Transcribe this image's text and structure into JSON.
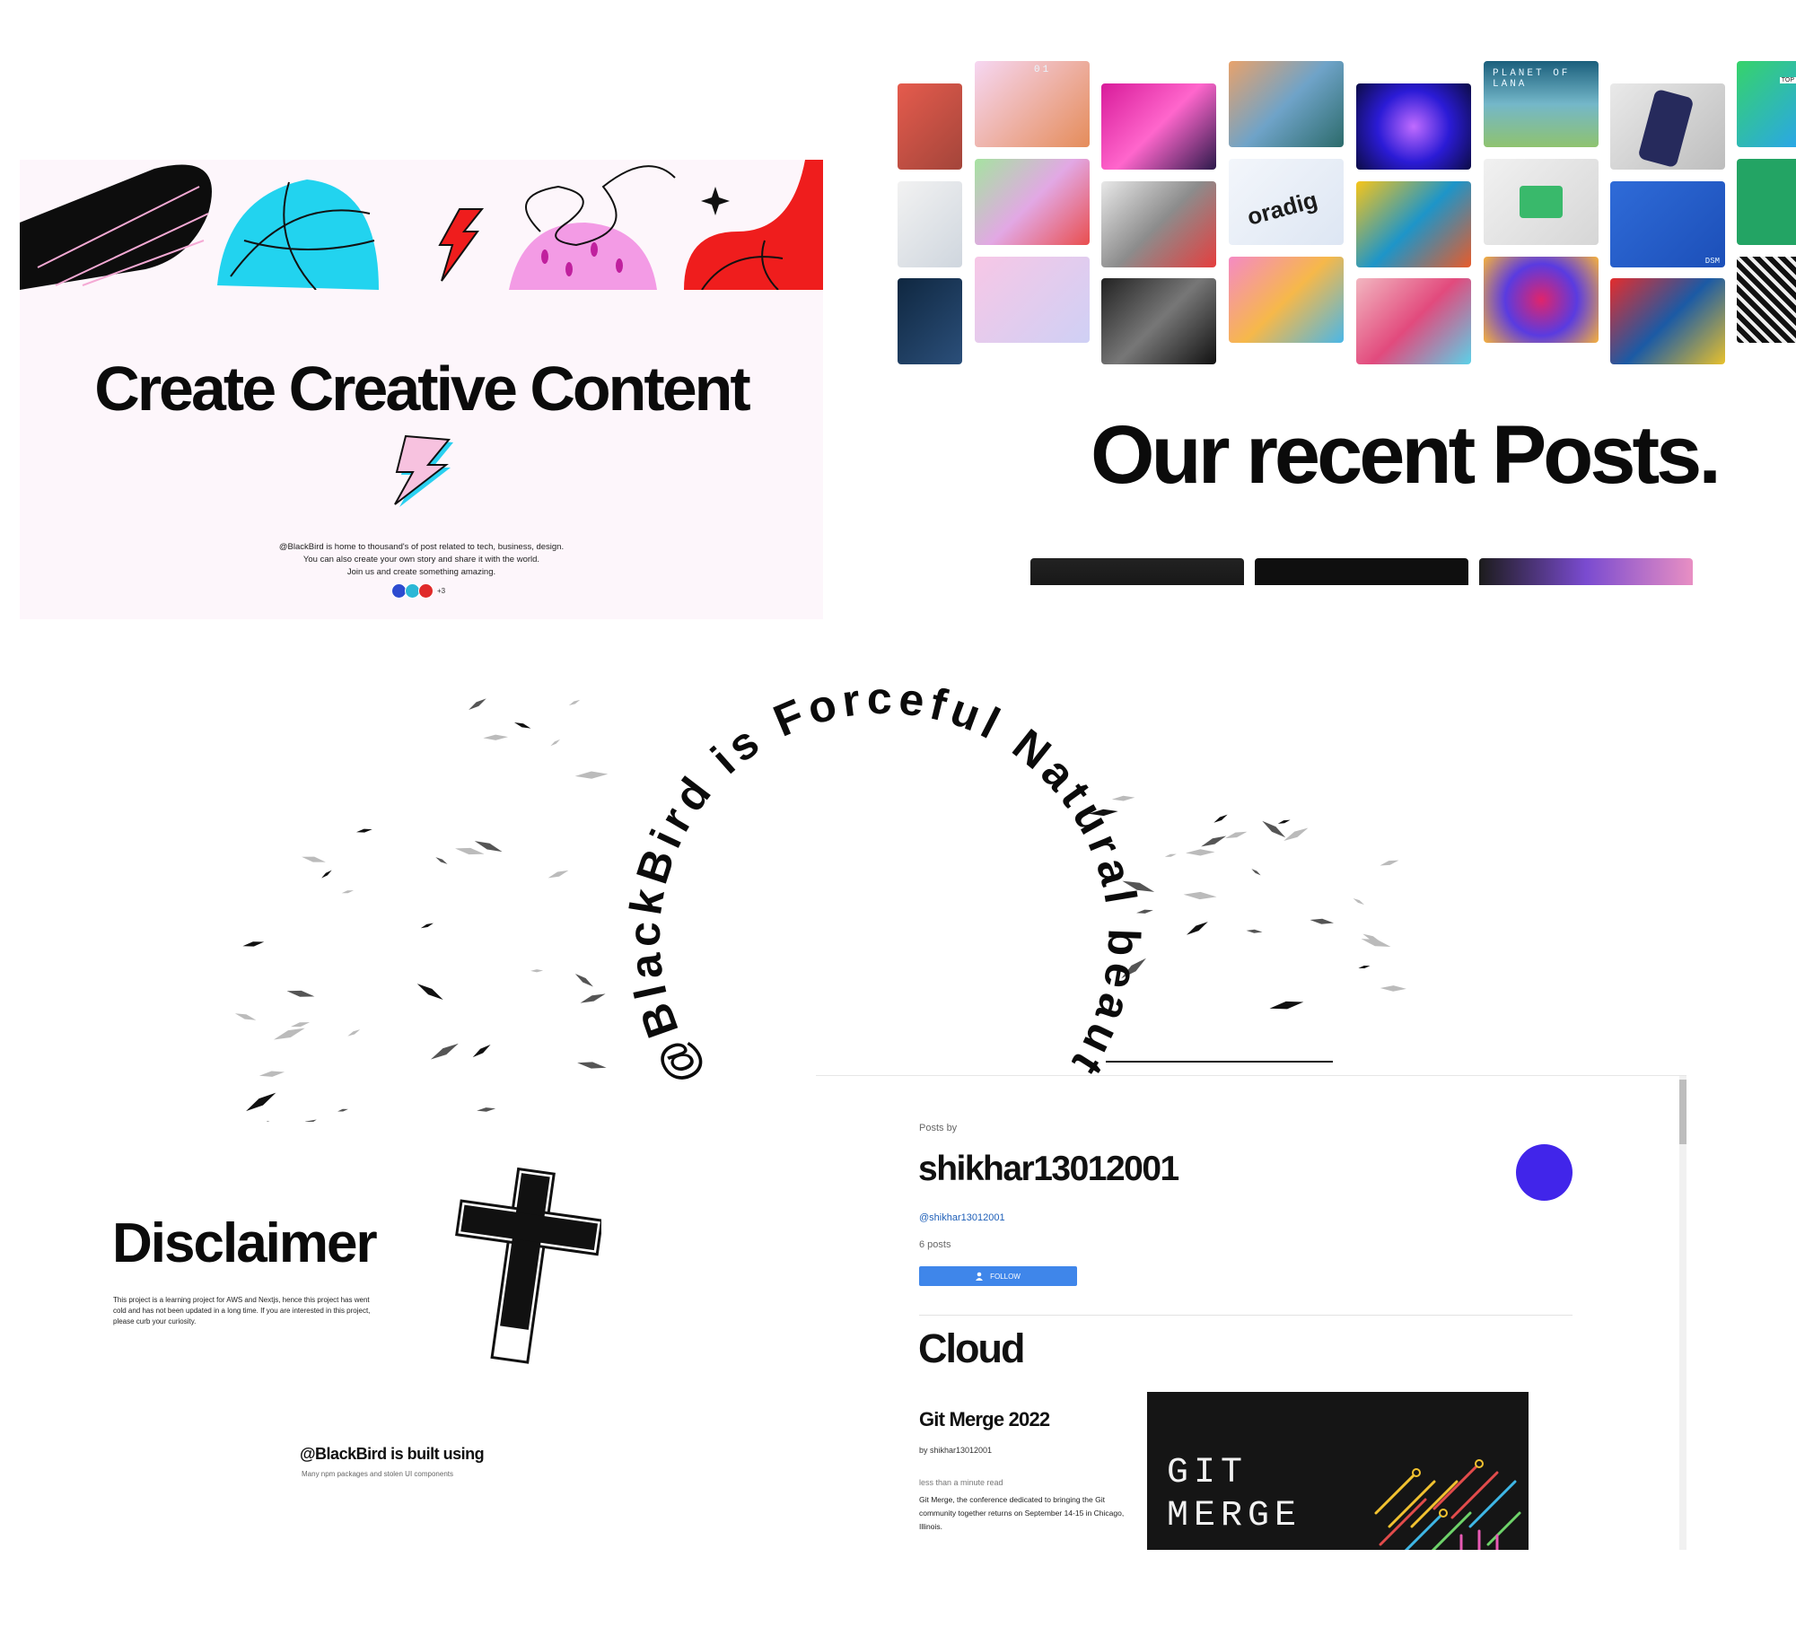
{
  "hero": {
    "title": "Create Creative Content",
    "description_lines": [
      "@BlackBird is home to thousand's of post related to tech, business, design.",
      "You can also create your own story and share it with the world.",
      "Join us and create something amazing."
    ],
    "avatar_count_extra": "+3",
    "colors": {
      "background": "#fdf6fb",
      "bolt": "#f7c2df",
      "bolt_shadow": "#2ad0f0"
    }
  },
  "gallery": {
    "tiles": [
      {
        "label": "PLANET OF LANA"
      },
      {
        "label": "oradig"
      },
      {
        "label": "DSM"
      },
      {
        "label": "01"
      },
      {
        "label": "TOP"
      }
    ]
  },
  "recent": {
    "title": "Our recent Posts."
  },
  "circle_text": {
    "text": "@BlackBird is Forceful Natural beautiful"
  },
  "disclaimer": {
    "title": "Disclaimer",
    "text": "This project is a learning project for AWS and Nextjs, hence this project has went cold and has not been updated in a long time. If you are interested in this project, please curb your curiosity."
  },
  "built_with": {
    "title": "@BlackBird is built using",
    "subtitle": "Many npm packages and stolen UI components"
  },
  "profile": {
    "posts_by_label": "Posts by",
    "name": "shikhar13012001",
    "handle": "@shikhar13012001",
    "post_count": "6 posts",
    "follow_label": "FOLLOW",
    "avatar_color": "#4125ea",
    "section": "Cloud",
    "post": {
      "title": "Git Merge 2022",
      "author": "by shikhar13012001",
      "read_time": "less than a minute read",
      "excerpt": "Git Merge, the conference dedicated to bringing the Git community together returns on September 14-15 in Chicago, Illinois.",
      "cover_line1": "GIT",
      "cover_line2": "MERGE"
    }
  }
}
